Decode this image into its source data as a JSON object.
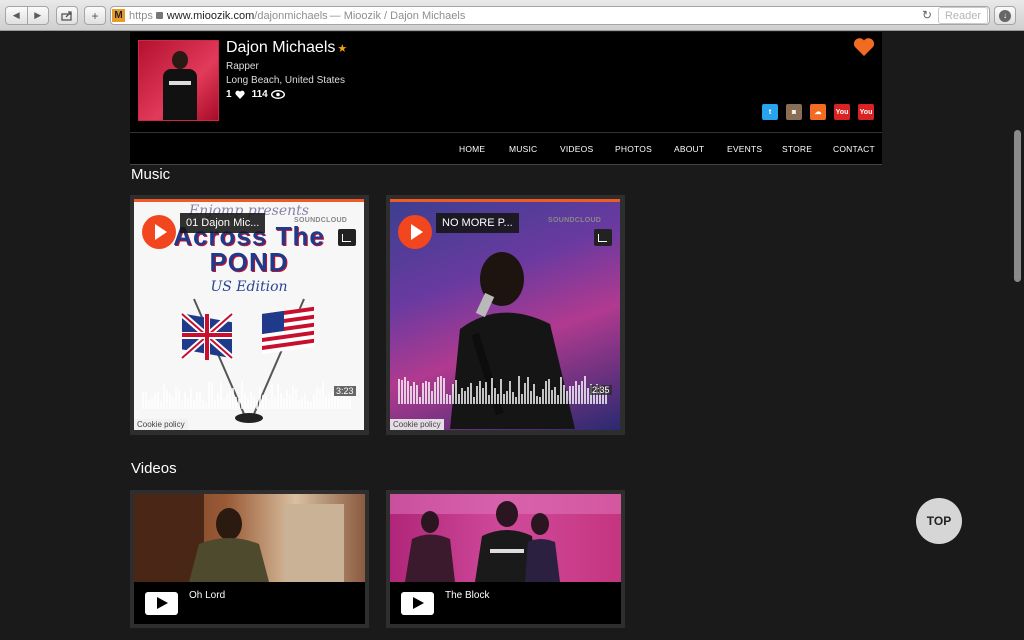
{
  "browser": {
    "url_scheme": "https",
    "url_host": "www.mioozik.com",
    "url_path": "/dajonmichaels",
    "page_title": "— Mioozik / Dajon Michaels",
    "reader_label": "Reader",
    "favicon_letter": "M"
  },
  "profile": {
    "name": "Dajon Michaels",
    "star": "★",
    "role": "Rapper",
    "location": "Long Beach, United States",
    "likes": "1",
    "views": "114",
    "social": [
      "twitter-icon",
      "instagram-icon",
      "soundcloud-icon",
      "youtube-icon",
      "youtube-icon"
    ]
  },
  "nav": {
    "items": [
      "HOME",
      "MUSIC",
      "VIDEOS",
      "PHOTOS",
      "ABOUT",
      "EVENTS",
      "STORE",
      "CONTACT"
    ]
  },
  "music": {
    "heading": "Music",
    "tracks": [
      {
        "title": "01 Dajon Mic...",
        "duration": "3:23",
        "source": "SOUNDCLOUD",
        "cookie": "Cookie policy",
        "art_text_1": "Across The",
        "art_text_2": "POND",
        "art_text_3": "US Edition"
      },
      {
        "title": "NO MORE P...",
        "duration": "2:35",
        "source": "SOUNDCLOUD",
        "cookie": "Cookie policy"
      }
    ]
  },
  "videos": {
    "heading": "Videos",
    "items": [
      {
        "title": "Oh Lord"
      },
      {
        "title": "The Block"
      }
    ]
  },
  "top_button": "TOP",
  "colors": {
    "accent": "#f05a24",
    "fav_heart": "#f26b22",
    "star": "#f2a20c"
  }
}
